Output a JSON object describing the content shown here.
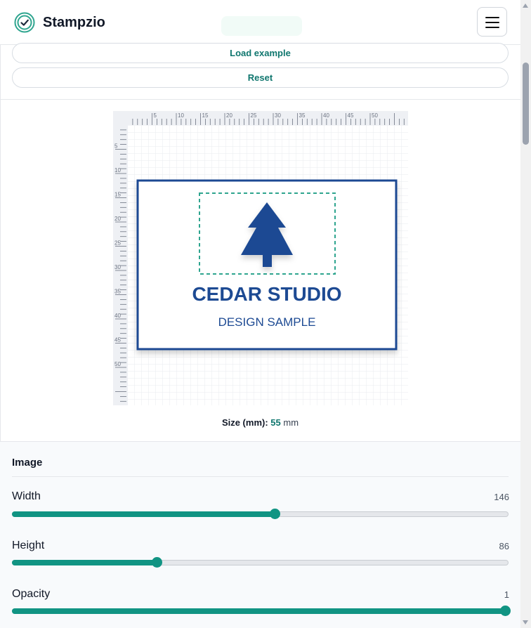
{
  "app": {
    "brand": "Stampzio",
    "logo_icon": "check-circle-icon",
    "menu_icon": "hamburger-menu-icon",
    "accent_color": "#119483",
    "stamp_color": "#1d4a93"
  },
  "actions": {
    "load_example_label": "Load example",
    "reset_label": "Reset"
  },
  "preview": {
    "ruler_top_labels": [
      "5",
      "10",
      "15",
      "20",
      "25",
      "30",
      "35",
      "40",
      "45",
      "50"
    ],
    "ruler_left_labels": [
      "5",
      "10",
      "15",
      "20",
      "25",
      "30",
      "35",
      "40",
      "45",
      "50"
    ],
    "stamp_title": "CEDAR STUDIO",
    "stamp_subtitle": "DESIGN SAMPLE",
    "stamp_image_icon": "pine-tree-icon",
    "size_label": "Size (mm):",
    "size_value": "55",
    "size_unit": "mm"
  },
  "panel": {
    "title": "Image",
    "sliders": [
      {
        "label": "Width",
        "value": "146",
        "fraction": 0.532
      },
      {
        "label": "Height",
        "value": "86",
        "fraction": 0.292
      },
      {
        "label": "Opacity",
        "value": "1",
        "fraction": 1.0
      }
    ]
  }
}
